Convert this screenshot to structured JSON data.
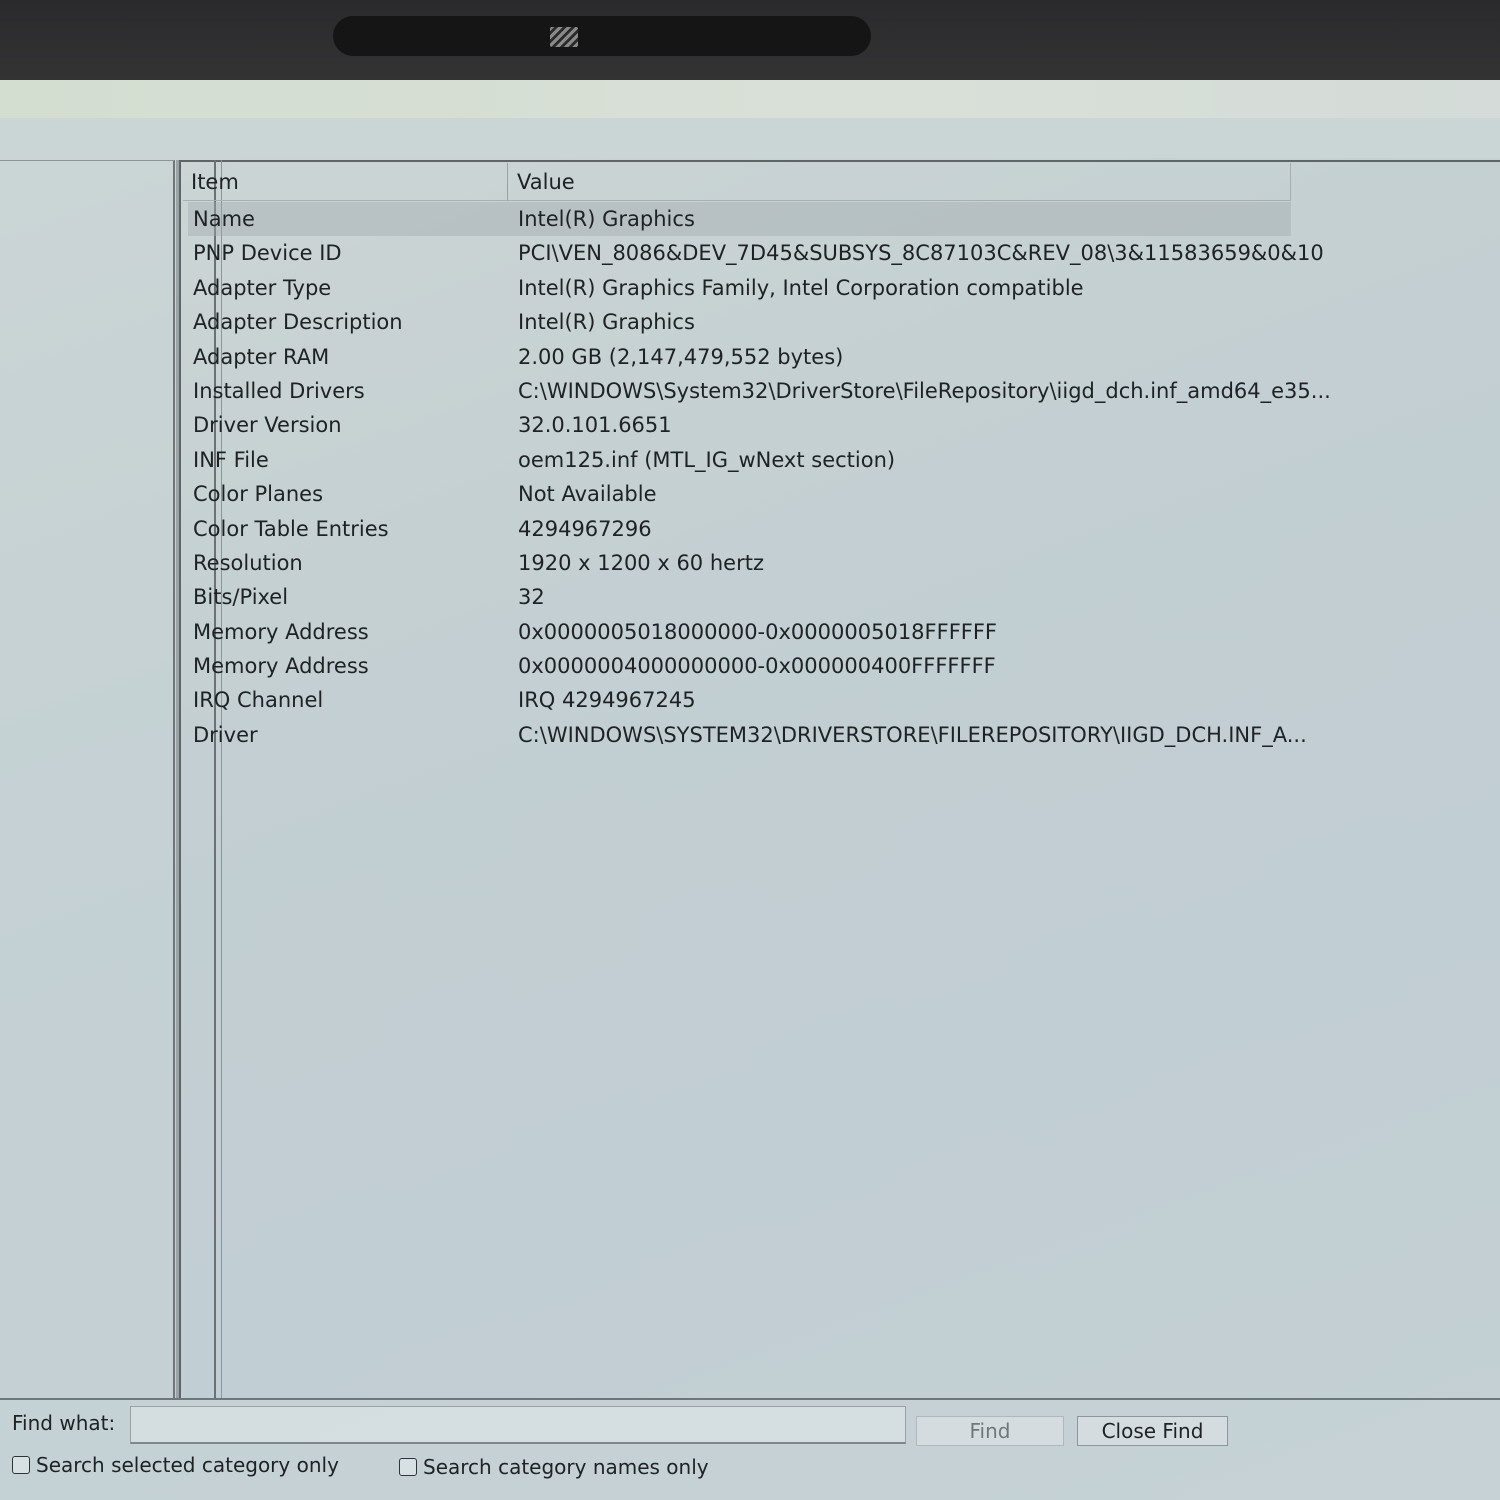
{
  "list": {
    "columns": {
      "item": "Item",
      "value": "Value"
    },
    "rows": [
      {
        "item": "Name",
        "value": "Intel(R) Graphics"
      },
      {
        "item": "PNP Device ID",
        "value": "PCI\\VEN_8086&DEV_7D45&SUBSYS_8C87103C&REV_08\\3&11583659&0&10"
      },
      {
        "item": "Adapter Type",
        "value": "Intel(R) Graphics Family, Intel Corporation compatible"
      },
      {
        "item": "Adapter Description",
        "value": "Intel(R) Graphics"
      },
      {
        "item": "Adapter RAM",
        "value": "2.00 GB (2,147,479,552 bytes)"
      },
      {
        "item": "Installed Drivers",
        "value": "C:\\WINDOWS\\System32\\DriverStore\\FileRepository\\iigd_dch.inf_amd64_e35..."
      },
      {
        "item": "Driver Version",
        "value": "32.0.101.6651"
      },
      {
        "item": "INF File",
        "value": "oem125.inf (MTL_IG_wNext section)"
      },
      {
        "item": "Color Planes",
        "value": "Not Available"
      },
      {
        "item": "Color Table Entries",
        "value": "4294967296"
      },
      {
        "item": "Resolution",
        "value": "1920 x 1200 x 60 hertz"
      },
      {
        "item": "Bits/Pixel",
        "value": "32"
      },
      {
        "item": "Memory Address",
        "value": "0x0000005018000000-0x0000005018FFFFFF"
      },
      {
        "item": "Memory Address",
        "value": "0x0000004000000000-0x000000400FFFFFFF"
      },
      {
        "item": "IRQ Channel",
        "value": "IRQ 4294967245"
      },
      {
        "item": "Driver",
        "value": "C:\\WINDOWS\\SYSTEM32\\DRIVERSTORE\\FILEREPOSITORY\\IIGD_DCH.INF_A..."
      }
    ]
  },
  "find": {
    "label": "Find what:",
    "value": "",
    "find_button": "Find",
    "close_button": "Close Find",
    "search_selected_label": "Search selected category only",
    "search_names_label": "Search category names only"
  }
}
